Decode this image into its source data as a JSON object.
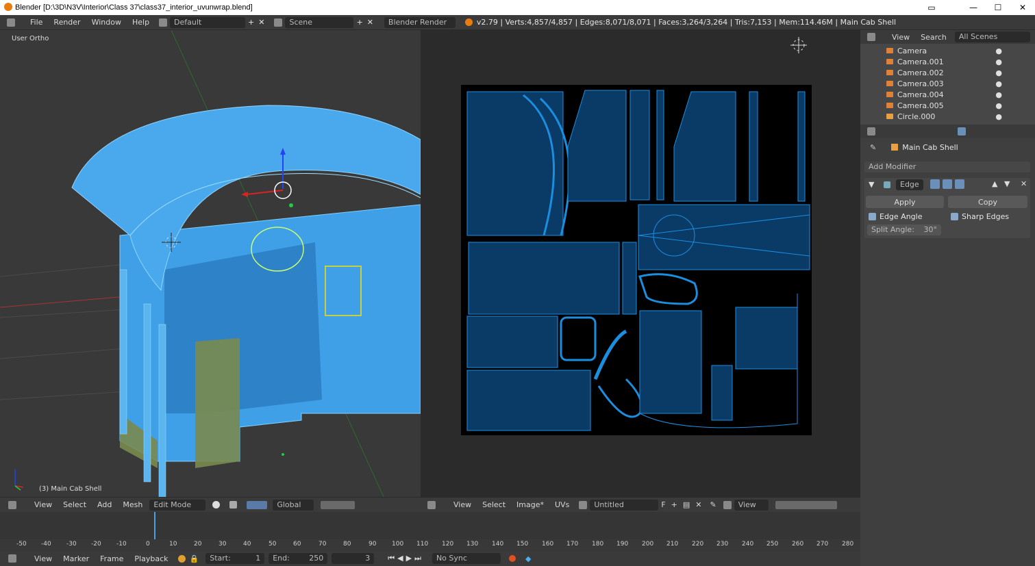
{
  "window": {
    "title": "Blender [D:\\3D\\N3V\\Interior\\Class 37\\class37_interior_uvunwrap.blend]"
  },
  "topbar": {
    "menus": [
      "File",
      "Render",
      "Window",
      "Help"
    ],
    "layout": "Default",
    "scene": "Scene",
    "engine": "Blender Render",
    "stats": "v2.79 | Verts:4,857/4,857 | Edges:8,071/8,071 | Faces:3,264/3,264 | Tris:7,153 | Mem:114.46M | Main Cab Shell"
  },
  "viewport": {
    "view_label": "User Ortho",
    "object_label": "(3) Main Cab Shell"
  },
  "viewport_header": {
    "menus": [
      "View",
      "Select",
      "Add",
      "Mesh"
    ],
    "mode": "Edit Mode",
    "orientation": "Global"
  },
  "uv_header": {
    "menus": [
      "View",
      "Select",
      "Image*",
      "UVs"
    ],
    "image_name": "Untitled",
    "flag": "F",
    "view_menu": "View"
  },
  "outliner": {
    "menus": [
      "View",
      "Search"
    ],
    "filter": "All Scenes",
    "items": [
      "Camera",
      "Camera.001",
      "Camera.002",
      "Camera.003",
      "Camera.004",
      "Camera.005",
      "Circle.000"
    ]
  },
  "properties": {
    "object_name": "Main Cab Shell",
    "add_modifier": "Add Modifier",
    "modifier_name": "Edge",
    "apply_label": "Apply",
    "copy_label": "Copy",
    "edge_angle_label": "Edge Angle",
    "sharp_edges_label": "Sharp Edges",
    "split_angle_label": "Split Angle:",
    "split_angle_value": "30°"
  },
  "timeline": {
    "ticks": [
      "-50",
      "-40",
      "-30",
      "-20",
      "-10",
      "0",
      "10",
      "20",
      "30",
      "40",
      "50",
      "60",
      "70",
      "80",
      "90",
      "100",
      "110",
      "120",
      "130",
      "140",
      "150",
      "160",
      "170",
      "180",
      "190",
      "200",
      "210",
      "220",
      "230",
      "240",
      "250",
      "260",
      "270",
      "280"
    ],
    "menus": [
      "View",
      "Marker",
      "Frame",
      "Playback"
    ],
    "start_label": "Start:",
    "start_value": "1",
    "end_label": "End:",
    "end_value": "250",
    "current_frame": "3",
    "sync": "No Sync"
  },
  "colors": {
    "mesh_blue": "#3fa0e8",
    "uv_blue": "#1a8fe0",
    "selection_yellow": "#c8d040",
    "bg_dark": "#2b2b2b"
  }
}
